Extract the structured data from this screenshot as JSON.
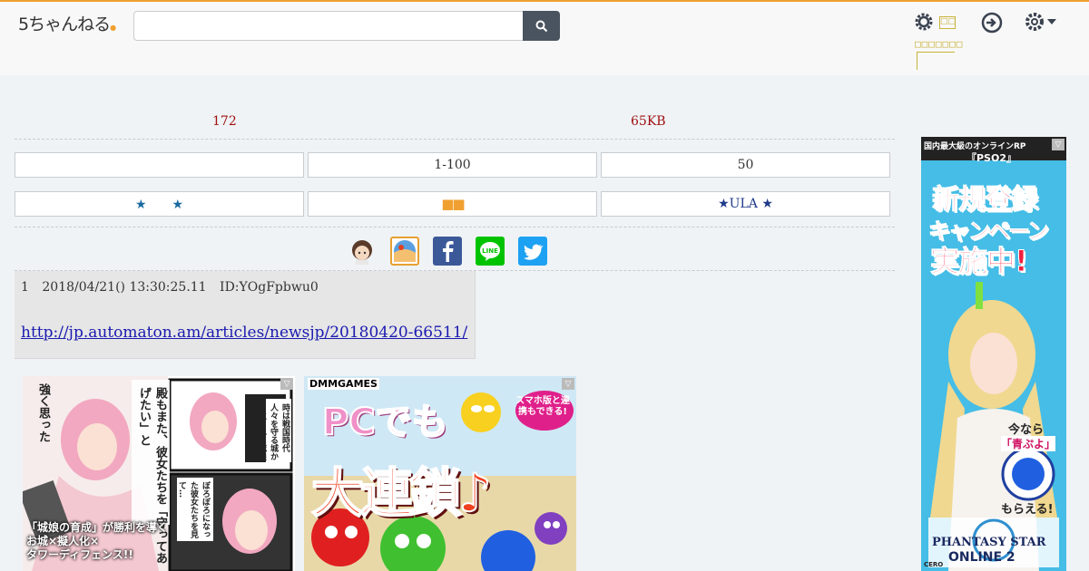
{
  "header": {
    "logo_text": "5ちゃんねる",
    "search_placeholder": "",
    "gear_label": "□□",
    "gear_sublabel": "□□□□□□□",
    "colors": {
      "accent": "#f0a030",
      "search_button": "#4a5360",
      "icon": "#3a4250"
    }
  },
  "thread_stats": {
    "count": "172",
    "size": "65KB"
  },
  "nav_buttons": {
    "row1": [
      "",
      "1-100",
      "50"
    ],
    "row2": [
      "★　　★",
      "■■",
      "★ULA ★"
    ]
  },
  "share": {
    "icons": [
      "avatar-icon",
      "dot-icon",
      "facebook-icon",
      "line-icon",
      "twitter-icon"
    ],
    "colors": {
      "facebook": "#3b5998",
      "line": "#00c300",
      "twitter": "#1da1f2"
    }
  },
  "post": {
    "number": "1",
    "date": "2018/04/21() 13:30:25.11",
    "id": "ID:YOgFpbwu0",
    "link": "http://jp.automaton.am/articles/newsjp/20180420-66511/"
  },
  "ads": {
    "ad1": {
      "badge": "▽",
      "caption_lines": [
        "「城娘の育成」が勝利を導く",
        "お城×擬人化×",
        "タワーディフェンス!!"
      ],
      "bubble1": "殿もまた、彼女たちを「守ってあげたい」と",
      "bubble2": "強く思った",
      "bubble3": "時は戦国時代 人々を守る城から生まれた城娘たち",
      "bubble4": "ぼろぼろになった彼女たちを見て…"
    },
    "ad2": {
      "badge": "▽",
      "brand": "DMMGAMES",
      "line1": "PCでも",
      "line2": "大連鎖♪",
      "bubble": "スマホ版と連携もできる!"
    },
    "ad3": {
      "badge": "▽",
      "top_line1": "国内最大級のオンラインRP",
      "top_line2": "『PSO2』",
      "headline1": "新規登録",
      "headline2": "キャンペーン",
      "headline3": "実施中!",
      "promo1": "今なら",
      "promo2": "「青ぷよ」",
      "promo3": "もらえる!",
      "logo1": "PHANTASY STAR",
      "logo2": "ONLINE 2",
      "cero": "CERO"
    }
  }
}
